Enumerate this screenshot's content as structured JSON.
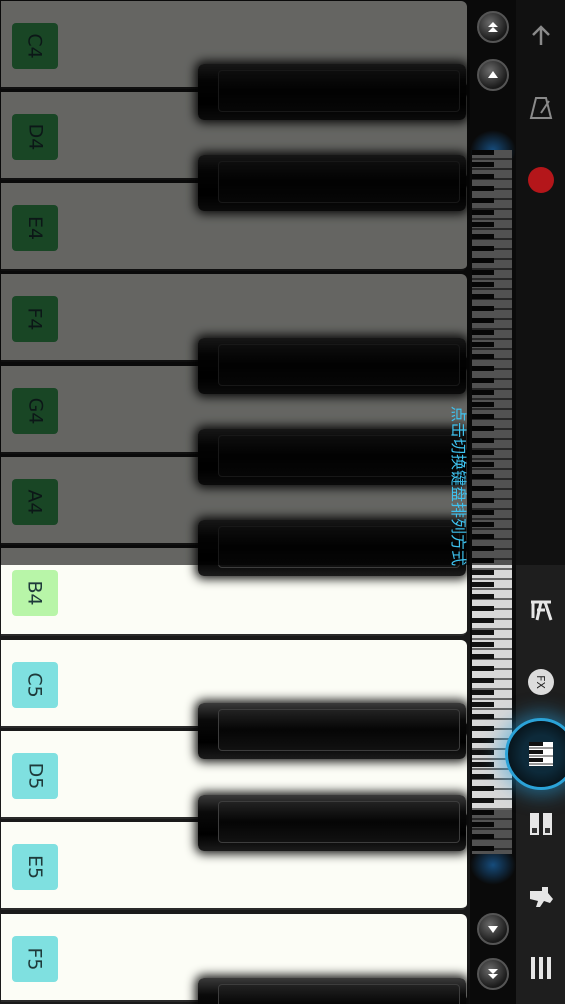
{
  "keyboard": {
    "white_keys": [
      {
        "note": "C4",
        "label_color": "#3fae5c"
      },
      {
        "note": "D4",
        "label_color": "#3fae5c"
      },
      {
        "note": "E4",
        "label_color": "#3fae5c"
      },
      {
        "note": "F4",
        "label_color": "#3fae5c"
      },
      {
        "note": "G4",
        "label_color": "#3fae5c"
      },
      {
        "note": "A4",
        "label_color": "#3fae5c"
      },
      {
        "note": "B4",
        "label_color": "#b8f5a8"
      },
      {
        "note": "C5",
        "label_color": "#7fe0e0"
      },
      {
        "note": "D5",
        "label_color": "#7fe0e0"
      },
      {
        "note": "E5",
        "label_color": "#7fe0e0"
      },
      {
        "note": "F5",
        "label_color": "#7fe0e0"
      }
    ]
  },
  "hint": {
    "text": "点击切换键盘排列方式"
  },
  "colors": {
    "accent": "#2ba3d8",
    "record": "#b4161a",
    "hint_text": "#3ec2ef"
  },
  "icons": {
    "scroll_top": "double-up-arrow-icon",
    "scroll_up": "up-arrow-icon",
    "scroll_down": "down-arrow-icon",
    "scroll_bottom": "double-down-arrow-icon",
    "back": "arrow-up-icon",
    "metronome": "metronome-icon",
    "record": "record-icon",
    "chord": "chord-icon",
    "fx": "fx-icon",
    "piano_mode": "piano-keyboard-icon",
    "dual_keyboard": "dual-keyboard-icon",
    "instrument": "instrument-icon",
    "menu": "menu-icon"
  },
  "sidebar": {
    "fx_label": "FX"
  }
}
